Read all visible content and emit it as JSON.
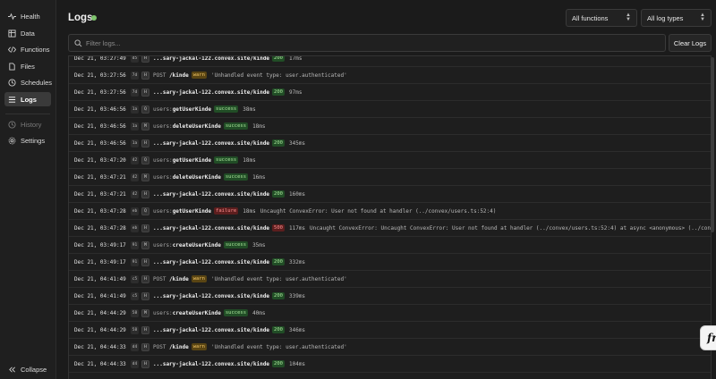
{
  "sidebar": {
    "items": [
      {
        "label": "Health",
        "icon": "pulse-icon"
      },
      {
        "label": "Data",
        "icon": "table-icon"
      },
      {
        "label": "Functions",
        "icon": "code-icon"
      },
      {
        "label": "Files",
        "icon": "file-icon"
      },
      {
        "label": "Schedules",
        "icon": "clock-icon"
      },
      {
        "label": "Logs",
        "icon": "list-icon",
        "active": true
      }
    ],
    "secondary": [
      {
        "label": "History",
        "icon": "history-icon",
        "dim": true
      },
      {
        "label": "Settings",
        "icon": "gear-icon"
      }
    ],
    "collapse_label": "Collapse"
  },
  "header": {
    "title": "Logs",
    "status_color": "#7fc46e",
    "functions_select": "All functions",
    "log_types_select": "All log types"
  },
  "filter": {
    "placeholder": "Filter logs..."
  },
  "clear_label": "Clear Logs",
  "badge_colors": {
    "success": "#a8e59a",
    "warn": "#f1c566",
    "failure": "#ff8f8f"
  },
  "logs": [
    {
      "ts": "Dec 21, 03:27:49",
      "rid": "d5",
      "kind": "H",
      "ns": "",
      "fn": "...sary-jackal-122.convex.site/kinde",
      "badge": "200",
      "dur": "17ms",
      "msg": ""
    },
    {
      "ts": "Dec 21, 03:27:56",
      "rid": "7d",
      "kind": "H",
      "ns": "POST ",
      "fn": "/kinde",
      "badge": "warn",
      "dur": "",
      "msg": "'Unhandled event type: user.authenticated'"
    },
    {
      "ts": "Dec 21, 03:27:56",
      "rid": "7d",
      "kind": "H",
      "ns": "",
      "fn": "...sary-jackal-122.convex.site/kinde",
      "badge": "200",
      "dur": "97ms",
      "msg": ""
    },
    {
      "ts": "Dec 21, 03:46:56",
      "rid": "1a",
      "kind": "Q",
      "ns": "users:",
      "fn": "getUserKinde",
      "badge": "success",
      "dur": "38ms",
      "msg": ""
    },
    {
      "ts": "Dec 21, 03:46:56",
      "rid": "1a",
      "kind": "M",
      "ns": "users:",
      "fn": "deleteUserKinde",
      "badge": "success",
      "dur": "18ms",
      "msg": ""
    },
    {
      "ts": "Dec 21, 03:46:56",
      "rid": "1a",
      "kind": "H",
      "ns": "",
      "fn": "...sary-jackal-122.convex.site/kinde",
      "badge": "200",
      "dur": "345ms",
      "msg": ""
    },
    {
      "ts": "Dec 21, 03:47:20",
      "rid": "42",
      "kind": "Q",
      "ns": "users:",
      "fn": "getUserKinde",
      "badge": "success",
      "dur": "18ms",
      "msg": ""
    },
    {
      "ts": "Dec 21, 03:47:21",
      "rid": "42",
      "kind": "M",
      "ns": "users:",
      "fn": "deleteUserKinde",
      "badge": "success",
      "dur": "16ms",
      "msg": ""
    },
    {
      "ts": "Dec 21, 03:47:21",
      "rid": "42",
      "kind": "H",
      "ns": "",
      "fn": "...sary-jackal-122.convex.site/kinde",
      "badge": "200",
      "dur": "160ms",
      "msg": ""
    },
    {
      "ts": "Dec 21, 03:47:28",
      "rid": "eb",
      "kind": "Q",
      "ns": "users:",
      "fn": "getUserKinde",
      "badge": "failure",
      "dur": "18ms",
      "msg": "Uncaught ConvexError: User not found at handler (../convex/users.ts:52:4)"
    },
    {
      "ts": "Dec 21, 03:47:28",
      "rid": "eb",
      "kind": "H",
      "ns": "",
      "fn": "...sary-jackal-122.convex.site/kinde",
      "badge": "500",
      "dur": "117ms",
      "msg": "Uncaught ConvexError: Uncaught ConvexError: User not found at handler (../convex/users.ts:52:4) at async <anonymous> (../convex/ht..."
    },
    {
      "ts": "Dec 21, 03:49:17",
      "rid": "91",
      "kind": "M",
      "ns": "users:",
      "fn": "createUserKinde",
      "badge": "success",
      "dur": "35ms",
      "msg": ""
    },
    {
      "ts": "Dec 21, 03:49:17",
      "rid": "91",
      "kind": "H",
      "ns": "",
      "fn": "...sary-jackal-122.convex.site/kinde",
      "badge": "200",
      "dur": "332ms",
      "msg": ""
    },
    {
      "ts": "Dec 21, 04:41:49",
      "rid": "c5",
      "kind": "H",
      "ns": "POST ",
      "fn": "/kinde",
      "badge": "warn",
      "dur": "",
      "msg": "'Unhandled event type: user.authenticated'"
    },
    {
      "ts": "Dec 21, 04:41:49",
      "rid": "c5",
      "kind": "H",
      "ns": "",
      "fn": "...sary-jackal-122.convex.site/kinde",
      "badge": "200",
      "dur": "339ms",
      "msg": ""
    },
    {
      "ts": "Dec 21, 04:44:29",
      "rid": "58",
      "kind": "M",
      "ns": "users:",
      "fn": "createUserKinde",
      "badge": "success",
      "dur": "40ms",
      "msg": ""
    },
    {
      "ts": "Dec 21, 04:44:29",
      "rid": "58",
      "kind": "H",
      "ns": "",
      "fn": "...sary-jackal-122.convex.site/kinde",
      "badge": "200",
      "dur": "346ms",
      "msg": ""
    },
    {
      "ts": "Dec 21, 04:44:33",
      "rid": "d4",
      "kind": "H",
      "ns": "POST ",
      "fn": "/kinde",
      "badge": "warn",
      "dur": "",
      "msg": "'Unhandled event type: user.authenticated'"
    },
    {
      "ts": "Dec 21, 04:44:33",
      "rid": "d4",
      "kind": "H",
      "ns": "",
      "fn": "...sary-jackal-122.convex.site/kinde",
      "badge": "200",
      "dur": "104ms",
      "msg": ""
    }
  ],
  "fab_label": "fr"
}
